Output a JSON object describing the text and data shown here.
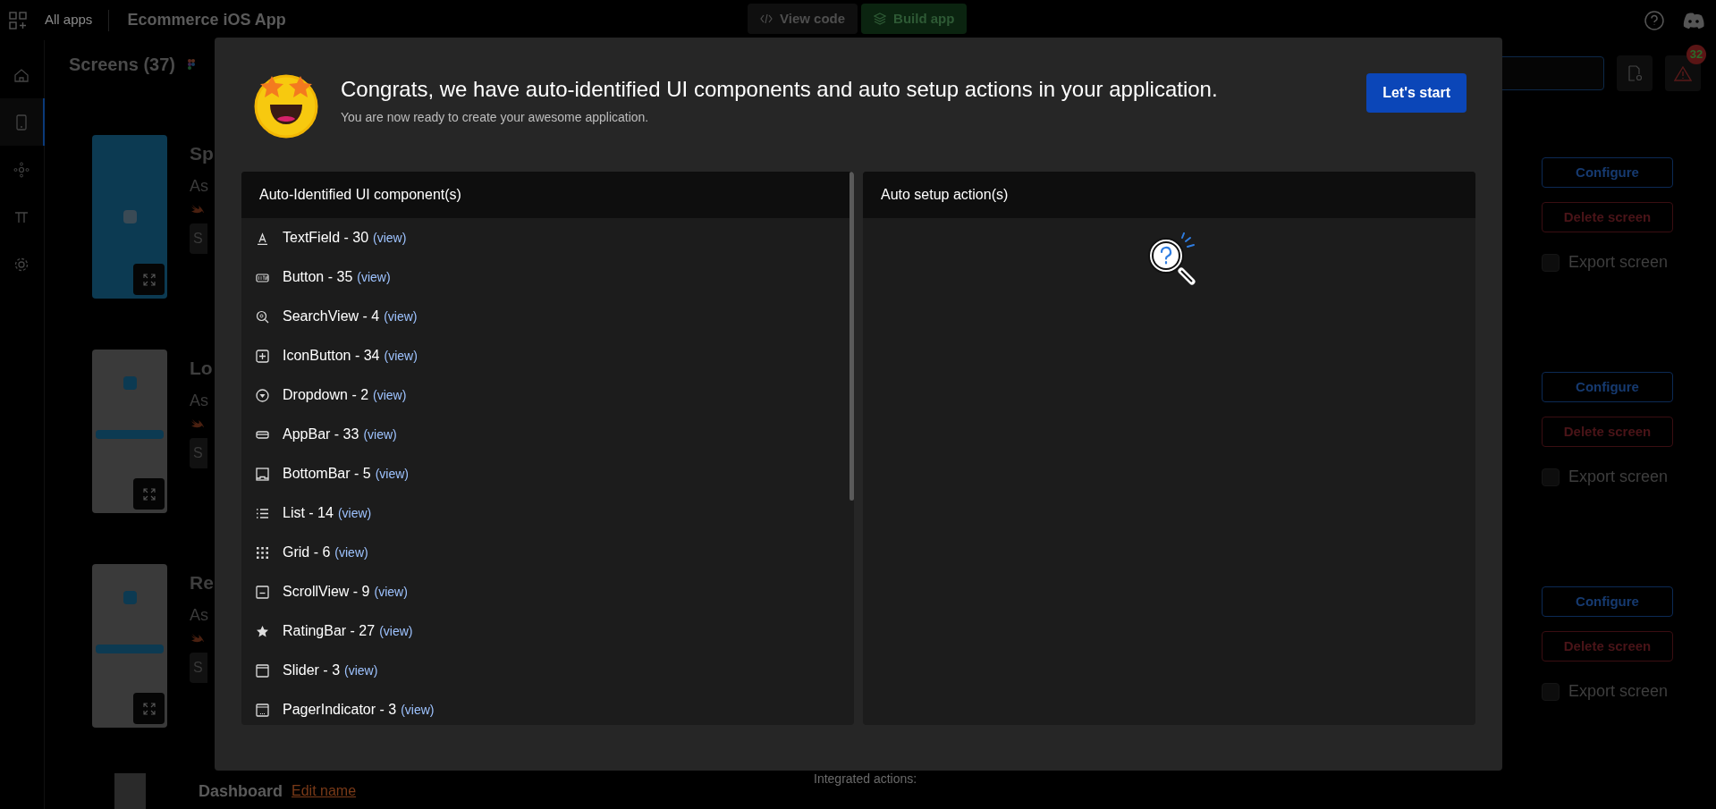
{
  "top_bar": {
    "apps_label": "All apps",
    "app_title": "Ecommerce iOS App",
    "buttons": [
      {
        "kind": "code",
        "label": "View code"
      },
      {
        "kind": "build",
        "label": "Build app"
      }
    ],
    "alert_badge": "32"
  },
  "sidebar": {
    "items": [
      {
        "kind": "home",
        "selected": false
      },
      {
        "kind": "phone",
        "selected": true
      },
      {
        "kind": "nodes",
        "selected": false
      },
      {
        "kind": "pi",
        "selected": false
      },
      {
        "kind": "settings",
        "selected": false
      }
    ]
  },
  "screens_header": {
    "title": "Screens (37)"
  },
  "screen_cards": [
    {
      "kind": "splash",
      "name": "Sp",
      "subtitle": "As",
      "chip": "S",
      "configure": "Configure",
      "delete": "Delete screen",
      "export": {
        "label": "Export screen",
        "checked": false
      }
    },
    {
      "kind": "form",
      "name": "Lo",
      "subtitle": "As",
      "chip": "S",
      "configure": "Configure",
      "delete": "Delete screen",
      "export": {
        "label": "Export screen",
        "checked": false
      }
    },
    {
      "kind": "form",
      "name": "Re",
      "subtitle": "As",
      "chip": "S",
      "configure": "Configure",
      "delete": "Delete screen",
      "export": {
        "label": "Export screen",
        "checked": false
      }
    }
  ],
  "dashboard": {
    "name": "Dashboard",
    "edit_link": "Edit name",
    "integrated_label": "Integrated actions:"
  },
  "modal": {
    "title": "Congrats, we have auto-identified UI components and auto setup actions in your application.",
    "subtitle": "You are now ready to create your awesome application.",
    "primary_button": "Let's start",
    "components_panel": {
      "title": "Auto-Identified UI component(s)",
      "items": [
        {
          "kind": "textfield",
          "label": "TextField - 30",
          "link": "(view)"
        },
        {
          "kind": "button",
          "label": "Button - 35",
          "link": "(view)"
        },
        {
          "kind": "search",
          "label": "SearchView - 4",
          "link": "(view)"
        },
        {
          "kind": "iconbutton",
          "label": "IconButton - 34",
          "link": "(view)"
        },
        {
          "kind": "dropdown",
          "label": "Dropdown - 2",
          "link": "(view)"
        },
        {
          "kind": "appbar",
          "label": "AppBar - 33",
          "link": "(view)"
        },
        {
          "kind": "bottombar",
          "label": "BottomBar - 5",
          "link": "(view)"
        },
        {
          "kind": "list",
          "label": "List - 14",
          "link": "(view)"
        },
        {
          "kind": "grid",
          "label": "Grid - 6",
          "link": "(view)"
        },
        {
          "kind": "scrollview",
          "label": "ScrollView - 9",
          "link": "(view)"
        },
        {
          "kind": "rating",
          "label": "RatingBar - 27",
          "link": "(view)"
        },
        {
          "kind": "slider",
          "label": "Slider - 3",
          "link": "(view)"
        },
        {
          "kind": "pager",
          "label": "PagerIndicator - 3",
          "link": "(view)"
        }
      ]
    },
    "actions_panel": {
      "title": "Auto setup action(s)"
    }
  }
}
